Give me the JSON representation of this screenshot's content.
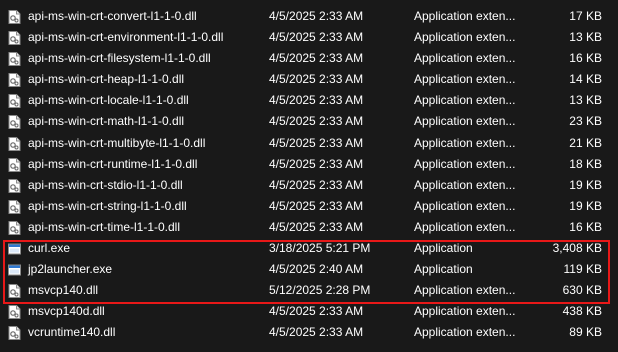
{
  "files": [
    {
      "name": "api-ms-win-crt-convert-l1-1-0.dll",
      "date": "4/5/2025 2:33 AM",
      "type": "Application exten...",
      "size": "17 KB",
      "icon": "dll-file-icon"
    },
    {
      "name": "api-ms-win-crt-environment-l1-1-0.dll",
      "date": "4/5/2025 2:33 AM",
      "type": "Application exten...",
      "size": "13 KB",
      "icon": "dll-file-icon"
    },
    {
      "name": "api-ms-win-crt-filesystem-l1-1-0.dll",
      "date": "4/5/2025 2:33 AM",
      "type": "Application exten...",
      "size": "16 KB",
      "icon": "dll-file-icon"
    },
    {
      "name": "api-ms-win-crt-heap-l1-1-0.dll",
      "date": "4/5/2025 2:33 AM",
      "type": "Application exten...",
      "size": "14 KB",
      "icon": "dll-file-icon"
    },
    {
      "name": "api-ms-win-crt-locale-l1-1-0.dll",
      "date": "4/5/2025 2:33 AM",
      "type": "Application exten...",
      "size": "13 KB",
      "icon": "dll-file-icon"
    },
    {
      "name": "api-ms-win-crt-math-l1-1-0.dll",
      "date": "4/5/2025 2:33 AM",
      "type": "Application exten...",
      "size": "23 KB",
      "icon": "dll-file-icon"
    },
    {
      "name": "api-ms-win-crt-multibyte-l1-1-0.dll",
      "date": "4/5/2025 2:33 AM",
      "type": "Application exten...",
      "size": "21 KB",
      "icon": "dll-file-icon"
    },
    {
      "name": "api-ms-win-crt-runtime-l1-1-0.dll",
      "date": "4/5/2025 2:33 AM",
      "type": "Application exten...",
      "size": "18 KB",
      "icon": "dll-file-icon"
    },
    {
      "name": "api-ms-win-crt-stdio-l1-1-0.dll",
      "date": "4/5/2025 2:33 AM",
      "type": "Application exten...",
      "size": "19 KB",
      "icon": "dll-file-icon"
    },
    {
      "name": "api-ms-win-crt-string-l1-1-0.dll",
      "date": "4/5/2025 2:33 AM",
      "type": "Application exten...",
      "size": "19 KB",
      "icon": "dll-file-icon"
    },
    {
      "name": "api-ms-win-crt-time-l1-1-0.dll",
      "date": "4/5/2025 2:33 AM",
      "type": "Application exten...",
      "size": "16 KB",
      "icon": "dll-file-icon"
    },
    {
      "name": "curl.exe",
      "date": "3/18/2025 5:21 PM",
      "type": "Application",
      "size": "3,408 KB",
      "icon": "exe-file-icon"
    },
    {
      "name": "jp2launcher.exe",
      "date": "4/5/2025 2:40 AM",
      "type": "Application",
      "size": "119 KB",
      "icon": "exe-file-icon"
    },
    {
      "name": "msvcp140.dll",
      "date": "5/12/2025 2:28 PM",
      "type": "Application exten...",
      "size": "630 KB",
      "icon": "dll-file-icon"
    },
    {
      "name": "msvcp140d.dll",
      "date": "4/5/2025 2:33 AM",
      "type": "Application exten...",
      "size": "438 KB",
      "icon": "dll-file-icon"
    },
    {
      "name": "vcruntime140.dll",
      "date": "4/5/2025 2:33 AM",
      "type": "Application exten...",
      "size": "89 KB",
      "icon": "dll-file-icon"
    }
  ],
  "highlight_color": "#e81818",
  "background_color": "#191919",
  "text_color": "#ffffff"
}
